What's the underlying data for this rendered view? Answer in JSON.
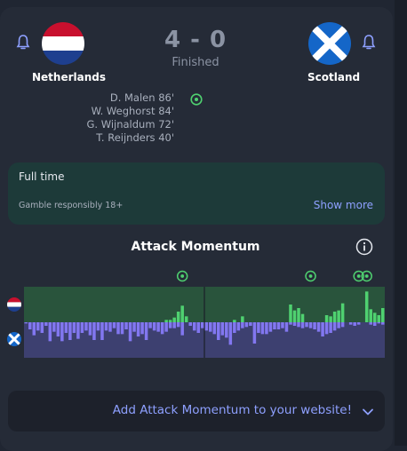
{
  "match": {
    "home": {
      "name": "Netherlands"
    },
    "away": {
      "name": "Scotland"
    },
    "score": "4 - 0",
    "status": "Finished",
    "scorers": [
      "D. Malen 86'",
      "W. Weghorst 84'",
      "G. Wijnaldum 72'",
      "T. Reijnders 40'"
    ]
  },
  "full_time": {
    "title": "Full time",
    "gamble": "Gamble responsibly 18+",
    "show_more": "Show more"
  },
  "momentum": {
    "title": "Attack Momentum",
    "home_goal_minutes": [
      40,
      72,
      84,
      86
    ],
    "halftime_minute": 45,
    "total_minutes": 90,
    "home": [
      0,
      0,
      0,
      0,
      0,
      0,
      0,
      0,
      0,
      0,
      0,
      0,
      0,
      0,
      0,
      0,
      0,
      0,
      0,
      0,
      0,
      0,
      0,
      0,
      0,
      0,
      0,
      0,
      0,
      0,
      0,
      0,
      0,
      0,
      0,
      2,
      2,
      4,
      9,
      14,
      5,
      0,
      0,
      0,
      0,
      0,
      0,
      0,
      0,
      0,
      0,
      0,
      2,
      0,
      5,
      0,
      0,
      0,
      0,
      0,
      0,
      0,
      0,
      0,
      0,
      0,
      15,
      10,
      12,
      7,
      0,
      0,
      0,
      0,
      0,
      6,
      5,
      9,
      10,
      16,
      0,
      0,
      0,
      0,
      0,
      26,
      11,
      8,
      6,
      12
    ],
    "away": [
      1,
      6,
      11,
      7,
      9,
      3,
      16,
      8,
      12,
      16,
      9,
      15,
      9,
      14,
      9,
      7,
      11,
      15,
      7,
      15,
      7,
      8,
      5,
      10,
      10,
      6,
      16,
      8,
      12,
      10,
      15,
      5,
      7,
      8,
      10,
      8,
      5,
      5,
      4,
      11,
      0,
      3,
      7,
      9,
      5,
      7,
      8,
      10,
      15,
      11,
      13,
      19,
      9,
      7,
      5,
      4,
      3,
      18,
      9,
      10,
      10,
      8,
      6,
      6,
      5,
      8,
      2,
      3,
      4,
      5,
      4,
      5,
      6,
      8,
      12,
      10,
      9,
      7,
      5,
      4,
      0,
      2,
      3,
      2,
      0,
      0,
      2,
      3,
      1,
      2
    ]
  },
  "footer": {
    "cta": "Add Attack Momentum to your website!"
  },
  "colors": {
    "home_bar": "#4fd170",
    "away_bar": "#8277f0",
    "home_zone": "#29543c",
    "away_zone": "#3d4070",
    "accent": "#8ea0ff",
    "goal_green": "#4fd170"
  }
}
